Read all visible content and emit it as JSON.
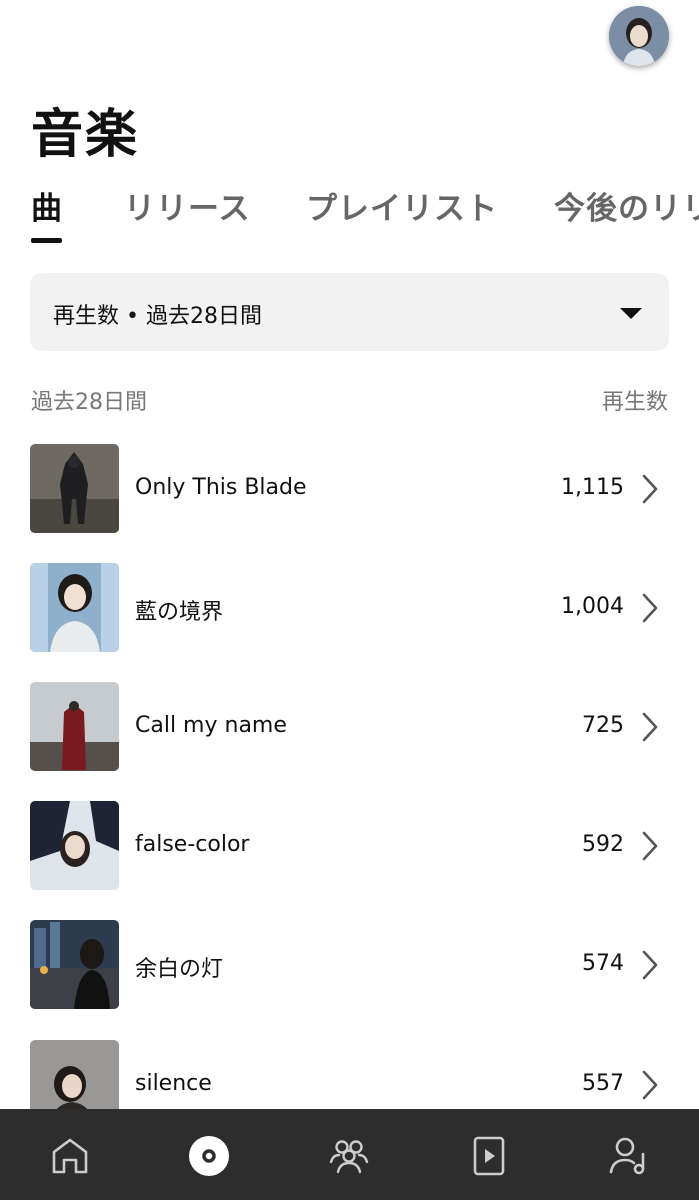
{
  "header": {
    "title": "音楽",
    "avatar_icon": "user-avatar"
  },
  "tabs": [
    {
      "label": "曲",
      "active": true
    },
    {
      "label": "リリース",
      "active": false
    },
    {
      "label": "プレイリスト",
      "active": false
    },
    {
      "label": "今後のリリ",
      "active": false
    }
  ],
  "filter": {
    "selected": "再生数 • 過去28日間",
    "icon": "caret-down-icon"
  },
  "list_header": {
    "period": "過去28日間",
    "metric": "再生数"
  },
  "tracks": [
    {
      "title": "Only This Blade",
      "plays": "1,115"
    },
    {
      "title": "藍の境界",
      "plays": "1,004"
    },
    {
      "title": "Call my name",
      "plays": "725"
    },
    {
      "title": "false-color",
      "plays": "592"
    },
    {
      "title": "余白の灯",
      "plays": "574"
    },
    {
      "title": "silence",
      "plays": "557"
    }
  ],
  "bottom_nav": [
    {
      "icon": "home-icon"
    },
    {
      "icon": "music-disc-icon",
      "active": true
    },
    {
      "icon": "audience-icon"
    },
    {
      "icon": "video-icon"
    },
    {
      "icon": "artist-icon"
    }
  ],
  "colors": {
    "text": "#111111",
    "muted": "#777777",
    "filter_bg": "#f2f2f2",
    "nav_bg": "#2d2d2d",
    "nav_icon": "#cccccc"
  }
}
